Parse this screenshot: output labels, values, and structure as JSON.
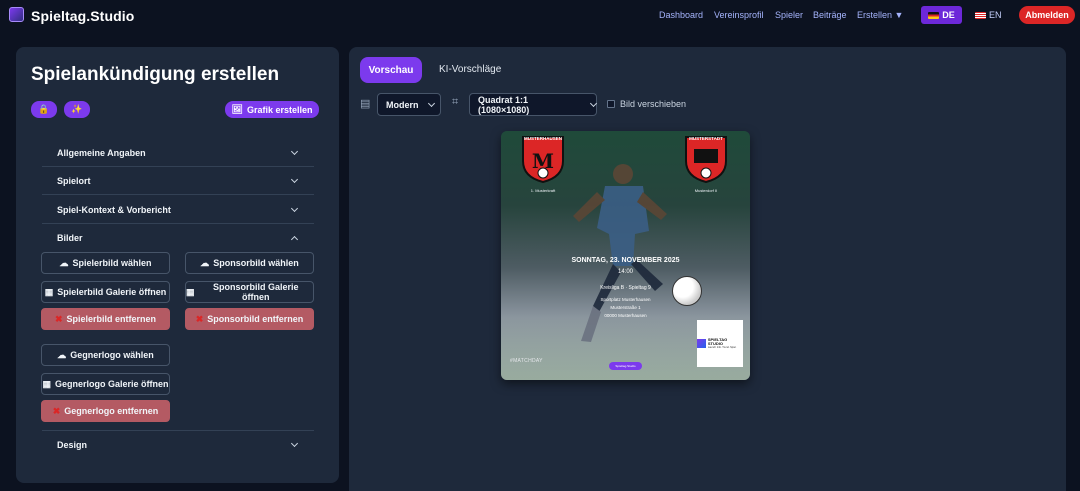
{
  "app": {
    "brand": "Spieltag.Studio"
  },
  "nav": {
    "items": [
      "Dashboard",
      "Vereinsprofil",
      "Spieler",
      "Beiträge",
      "Erstellen ▼"
    ],
    "lang_de": "DE",
    "lang_en": "EN",
    "logout": "Abmelden"
  },
  "sidebar": {
    "title": "Spielankündigung erstellen",
    "create_button": "Grafik erstellen",
    "sections": {
      "allgemein": "Allgemeine Angaben",
      "spielort": "Spielort",
      "kontext": "Spiel-Kontext & Vorbericht",
      "bilder": "Bilder",
      "design": "Design"
    },
    "images": {
      "player_choose": "Spielerbild wählen",
      "sponsor_choose": "Sponsorbild wählen",
      "player_gallery": "Spielerbild Galerie öffnen",
      "sponsor_gallery": "Sponsorbild Galerie öffnen",
      "player_remove": "Spielerbild entfernen",
      "sponsor_remove": "Sponsorbild entfernen",
      "opponent_choose": "Gegnerlogo wählen",
      "opponent_gallery": "Gegnerlogo Galerie öffnen",
      "opponent_remove": "Gegnerlogo entfernen"
    }
  },
  "preview_area": {
    "tabs": [
      "Vorschau",
      "KI-Vorschläge"
    ],
    "style_select": "Modern",
    "format_select": "Quadrat 1:1 (1080×1080)",
    "move_image_label": "Bild verschieben"
  },
  "graphic": {
    "home_club": "MUSTERHAUSEN",
    "home_crest_letter": "M",
    "home_caption": "1. Musterkraft",
    "away_club": "MUSTERSTADT",
    "away_caption": "Musterdorf II",
    "date": "SONNTAG, 23. NOVEMBER 2025",
    "time": "14:00",
    "league": "Kreisliga B · Spieltag 9",
    "venue": "Sportplatz Musterhausen",
    "street": "Musterstraße 1",
    "city": "00000 Musterhausen",
    "hashtag": "#MATCHDAY",
    "badge": "Spieltag.Studio",
    "sponsor_name": "SPIELTAG STUDIO",
    "sponsor_tagline": "Launch Info. Trend. Spiel."
  }
}
